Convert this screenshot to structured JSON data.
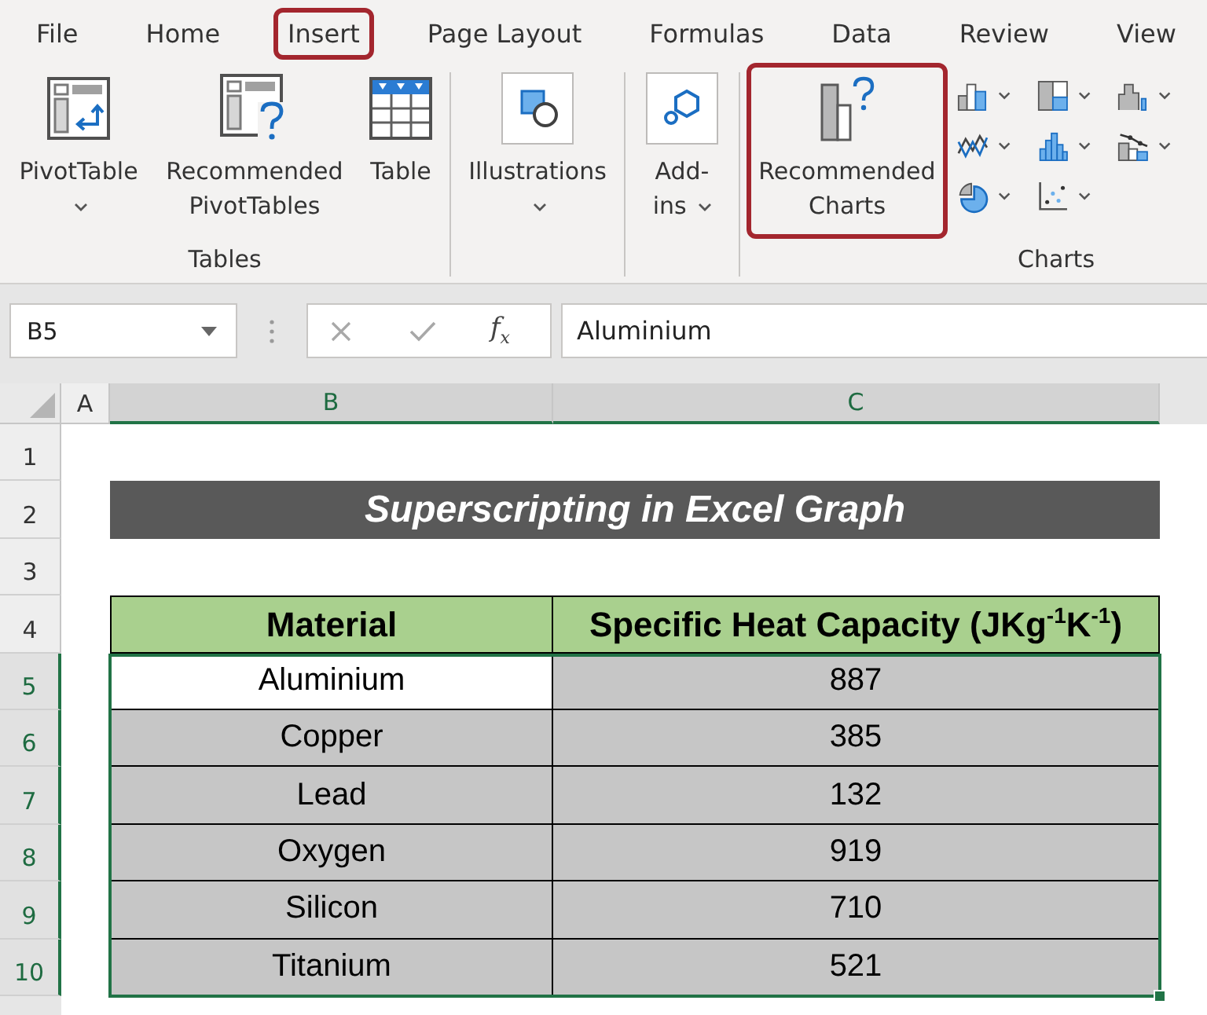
{
  "ribbon_tabs": [
    {
      "label": "File",
      "highlighted": false
    },
    {
      "label": "Home",
      "highlighted": false
    },
    {
      "label": "Insert",
      "highlighted": true
    },
    {
      "label": "Page Layout",
      "highlighted": false
    },
    {
      "label": "Formulas",
      "highlighted": false
    },
    {
      "label": "Data",
      "highlighted": false
    },
    {
      "label": "Review",
      "highlighted": false
    },
    {
      "label": "View",
      "highlighted": false
    }
  ],
  "ribbon_groups": [
    {
      "label": "Tables",
      "commands": [
        {
          "kind": "pivot-table",
          "label": "PivotTable",
          "dropdown": true,
          "highlighted": false
        },
        {
          "kind": "recommended-pivot-tables",
          "label": "Recommended PivotTables",
          "dropdown": false,
          "highlighted": false
        },
        {
          "kind": "table",
          "label": "Table",
          "dropdown": false,
          "highlighted": false
        }
      ]
    },
    {
      "commands": [
        {
          "kind": "illustrations",
          "label": "Illustrations",
          "dropdown": true,
          "highlighted": false
        }
      ]
    },
    {
      "commands": [
        {
          "kind": "add-ins",
          "label": "Add-ins",
          "dropdown": true,
          "highlighted": false
        }
      ]
    },
    {
      "label": "Charts",
      "commands": [
        {
          "kind": "recommended-charts",
          "label": "Recommended Charts",
          "dropdown": false,
          "highlighted": true
        },
        {
          "kind": "chart-gallery"
        }
      ]
    }
  ],
  "formula_bar": {
    "name_box": "B5",
    "function_button": "f$_{x}$",
    "formula": "Aluminium"
  },
  "sheet": {
    "columns": [
      {
        "label": "A",
        "selected": false
      },
      {
        "label": "B",
        "selected": true
      },
      {
        "label": "C",
        "selected": true
      }
    ],
    "rows": [
      {
        "label": "1",
        "selected": false
      },
      {
        "label": "2",
        "selected": false
      },
      {
        "label": "3",
        "selected": false
      },
      {
        "label": "4",
        "selected": false
      },
      {
        "label": "5",
        "selected": true
      },
      {
        "label": "6",
        "selected": true
      },
      {
        "label": "7",
        "selected": true
      },
      {
        "label": "8",
        "selected": true
      },
      {
        "label": "9",
        "selected": true
      },
      {
        "label": "10",
        "selected": true
      }
    ],
    "title": "Superscripting in Excel Graph",
    "table": {
      "header": [
        "Material",
        "Specific Heat Capacity (JKg$^{-1}$K$^{-1}$)"
      ],
      "rows": [
        {
          "selected": true,
          "cells": [
            {
              "value": "Aluminium",
              "active": true
            },
            {
              "value": "887",
              "active": false
            }
          ]
        },
        {
          "selected": true,
          "cells": [
            {
              "value": "Copper",
              "active": false
            },
            {
              "value": "385",
              "active": false
            }
          ]
        },
        {
          "selected": true,
          "cells": [
            {
              "value": "Lead",
              "active": false
            },
            {
              "value": "132",
              "active": false
            }
          ]
        },
        {
          "selected": true,
          "cells": [
            {
              "value": "Oxygen",
              "active": false
            },
            {
              "value": "919",
              "active": false
            }
          ]
        },
        {
          "selected": true,
          "cells": [
            {
              "value": "Silicon",
              "active": false
            },
            {
              "value": "710",
              "active": false
            }
          ]
        },
        {
          "selected": true,
          "cells": [
            {
              "value": "Titanium",
              "active": false
            },
            {
              "value": "521",
              "active": false
            }
          ]
        }
      ]
    }
  }
}
